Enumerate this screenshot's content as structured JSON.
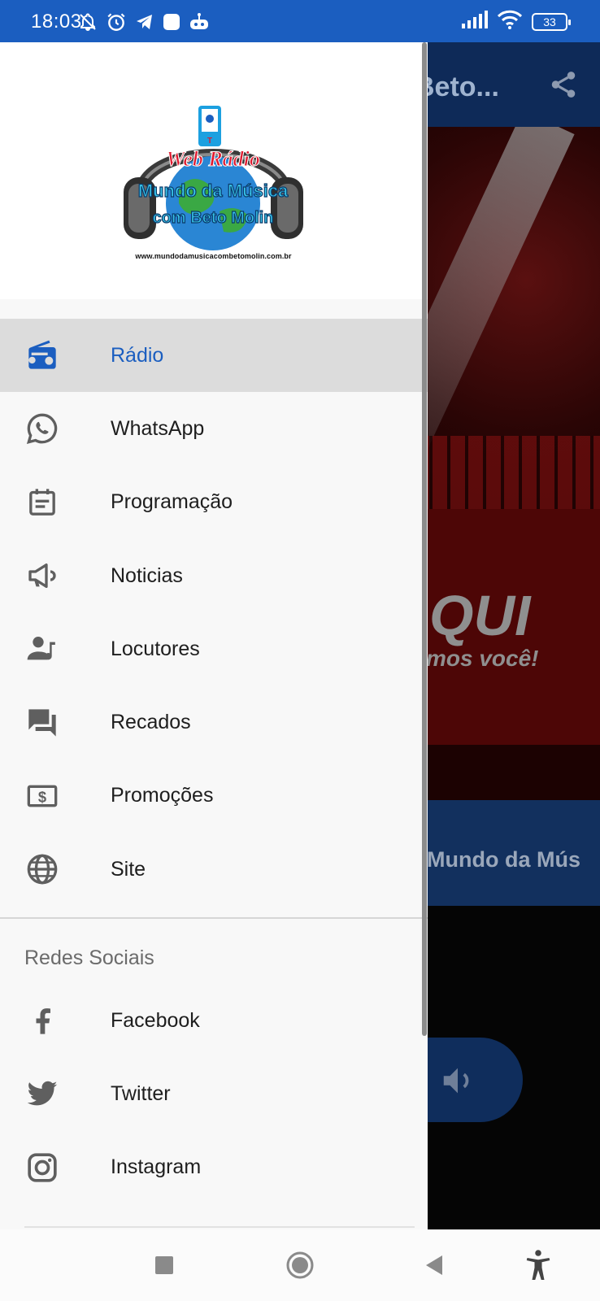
{
  "status_bar": {
    "time": "18:03",
    "battery": "33",
    "icons_left": [
      "bell-off-icon",
      "alarm-icon",
      "telegram-icon",
      "app-square-icon",
      "android-robot-icon"
    ],
    "icons_right": [
      "signal-icon",
      "wifi-icon",
      "battery-icon"
    ]
  },
  "background_app": {
    "title": "Beto...",
    "banner_text": "QUI",
    "banner_subtext": "mos você!",
    "station_text": "Mundo da Mús"
  },
  "drawer": {
    "logo": {
      "line1": "Web Rádio",
      "line2": "Mundo da Música",
      "line3": "com Beto Molin",
      "url": "www.mundodamusicacombetomolin.com.br"
    },
    "menu": [
      {
        "label": "Rádio",
        "icon": "radio-icon",
        "active": true
      },
      {
        "label": "WhatsApp",
        "icon": "whatsapp-icon",
        "active": false
      },
      {
        "label": "Programação",
        "icon": "calendar-icon",
        "active": false
      },
      {
        "label": "Noticias",
        "icon": "megaphone-icon",
        "active": false
      },
      {
        "label": "Locutores",
        "icon": "person-music-icon",
        "active": false
      },
      {
        "label": "Recados",
        "icon": "chat-bubbles-icon",
        "active": false
      },
      {
        "label": "Promoções",
        "icon": "money-icon",
        "active": false
      },
      {
        "label": "Site",
        "icon": "globe-icon",
        "active": false
      }
    ],
    "section_title": "Redes Sociais",
    "social": [
      {
        "label": "Facebook",
        "icon": "facebook-icon"
      },
      {
        "label": "Twitter",
        "icon": "twitter-icon"
      },
      {
        "label": "Instagram",
        "icon": "instagram-icon"
      }
    ]
  },
  "nav_bar": {
    "buttons": [
      "recent-apps-icon",
      "home-icon",
      "back-icon",
      "accessibility-icon"
    ]
  },
  "colors": {
    "accent": "#1b5ec0",
    "active_row": "#dcdcdc",
    "icon_gray": "#5f5f5f"
  }
}
